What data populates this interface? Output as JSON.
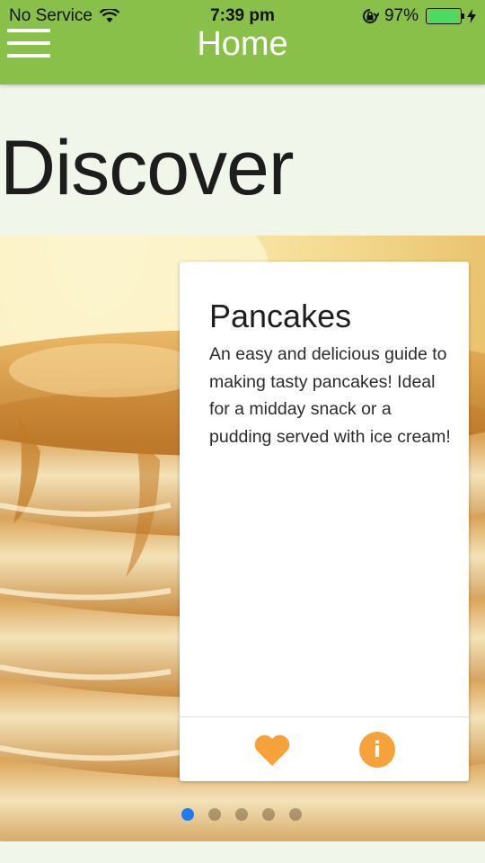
{
  "status_bar": {
    "carrier": "No Service",
    "time": "7:39 pm",
    "battery": "97%",
    "battery_level": 0.97,
    "icons": [
      "wifi-icon",
      "rotation-lock-icon",
      "battery-icon",
      "charging-bolt-icon"
    ]
  },
  "nav": {
    "title": "Home",
    "menu_icon": "hamburger-menu-icon"
  },
  "page": {
    "heading": "Discover"
  },
  "card": {
    "title": "Pancakes",
    "description": "An easy and delicious guide to making tasty pancakes! Ideal for a midday snack or a pudding served with ice cream!",
    "actions": [
      {
        "name": "favorite",
        "icon": "heart-icon"
      },
      {
        "name": "info",
        "icon": "info-icon",
        "glyph": "i"
      }
    ]
  },
  "carousel": {
    "page_count": 5,
    "active_page": 1
  },
  "colors": {
    "header_green": "#88c049",
    "background": "#f1f6ea",
    "accent_orange": "#f6a13a",
    "active_dot": "#1e7cf2"
  }
}
